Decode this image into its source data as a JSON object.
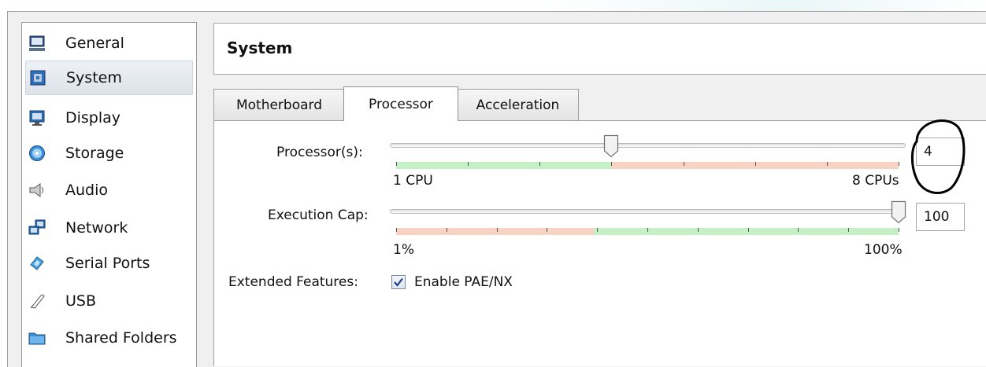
{
  "sidebar": {
    "items": [
      {
        "label": "General",
        "icon": "monitor-icon"
      },
      {
        "label": "System",
        "icon": "chip-icon",
        "selected": true
      },
      {
        "label": "Display",
        "icon": "display-icon"
      },
      {
        "label": "Storage",
        "icon": "disc-icon"
      },
      {
        "label": "Audio",
        "icon": "speaker-icon"
      },
      {
        "label": "Network",
        "icon": "network-icon"
      },
      {
        "label": "Serial Ports",
        "icon": "serial-port-icon"
      },
      {
        "label": "USB",
        "icon": "usb-icon"
      },
      {
        "label": "Shared Folders",
        "icon": "folder-icon"
      }
    ]
  },
  "header": {
    "title": "System"
  },
  "tabs": [
    {
      "label": "Motherboard"
    },
    {
      "label": "Processor",
      "active": true
    },
    {
      "label": "Acceleration"
    }
  ],
  "processor": {
    "processors_label": "Processor(s):",
    "processors_value": "4",
    "processors_min_label": "1 CPU",
    "processors_max_label": "8 CPUs",
    "processors_min": 1,
    "processors_max": 8,
    "processors_recommended_max": 4,
    "exec_cap_label": "Execution Cap:",
    "exec_cap_value": "100",
    "exec_cap_min_label": "1%",
    "exec_cap_max_label": "100%",
    "exec_cap_min": 1,
    "exec_cap_max": 100,
    "exec_cap_warning_below": 40,
    "extended_label": "Extended Features:",
    "pae_label": "Enable PAE/NX",
    "pae_checked": true
  },
  "colors": {
    "scale_ok": "#c5f0c5",
    "scale_warn": "#f8d3c3",
    "annotation": "#000000"
  }
}
